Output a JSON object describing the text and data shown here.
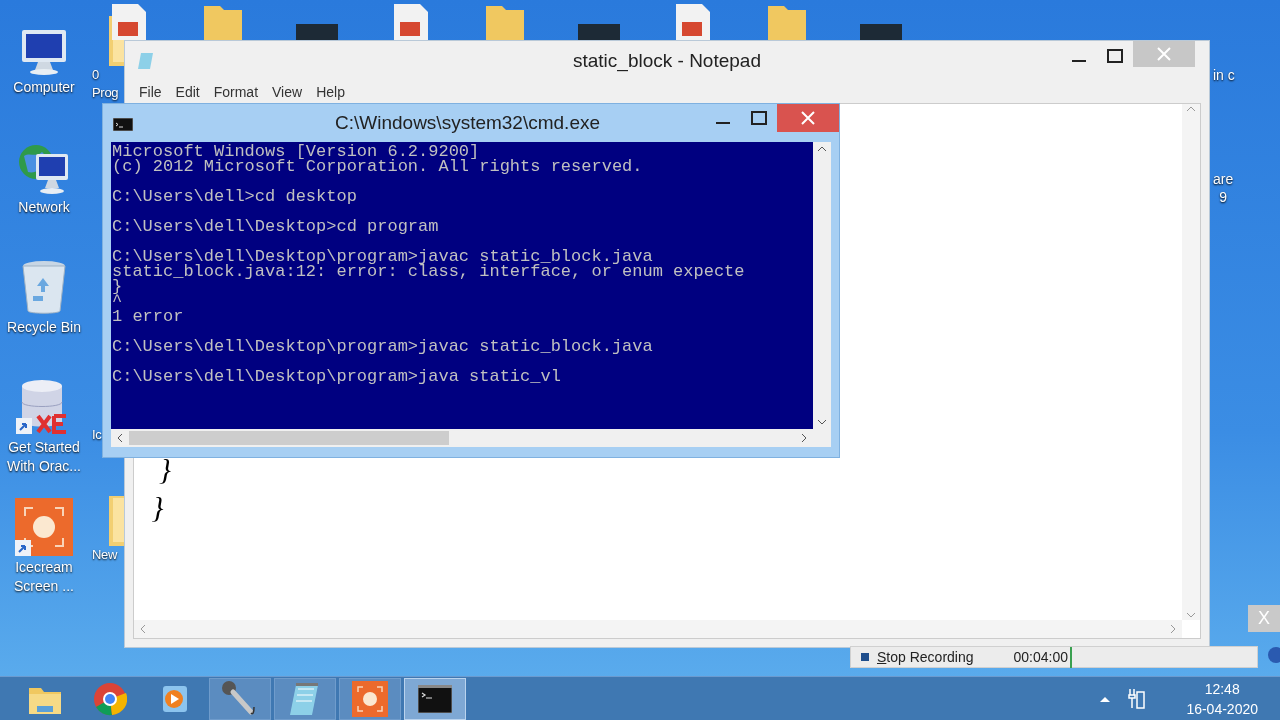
{
  "desktop_icons": [
    {
      "label": "Computer",
      "kind": "computer"
    },
    {
      "label": "Network",
      "kind": "network"
    },
    {
      "label": "Recycle Bin",
      "kind": "recycle"
    },
    {
      "label": "Get Started With Orac...",
      "kind": "database"
    },
    {
      "label": "Icecream Screen ...",
      "kind": "recorder"
    }
  ],
  "partial_icons_left": [
    {
      "lines": [
        "0",
        "Prog"
      ]
    },
    {
      "lines": [
        "Ic"
      ]
    },
    {
      "lines": [
        "New"
      ]
    }
  ],
  "partial_icons_right": [
    {
      "lines": [
        "in c"
      ]
    },
    {
      "lines": [
        "are",
        "9"
      ]
    }
  ],
  "notepad": {
    "title": "static_block - Notepad",
    "menu": [
      "File",
      "Edit",
      "Format",
      "View",
      "Help"
    ],
    "lines": [
      "  }",
      " }"
    ]
  },
  "cmd": {
    "title": "C:\\Windows\\system32\\cmd.exe",
    "blocks": [
      [
        "Microsoft Windows [Version 6.2.9200]",
        "(c) 2012 Microsoft Corporation. All rights reserved."
      ],
      [
        "C:\\Users\\dell>cd desktop"
      ],
      [
        "C:\\Users\\dell\\Desktop>cd program"
      ],
      [
        "C:\\Users\\dell\\Desktop\\program>javac static_block.java",
        "static_block.java:12: error: class, interface, or enum expecte",
        "}",
        "^",
        "1 error"
      ],
      [
        "C:\\Users\\dell\\Desktop\\program>javac static_block.java"
      ],
      [
        "C:\\Users\\dell\\Desktop\\program>java static_vl"
      ]
    ]
  },
  "recording": {
    "stop_key": "S",
    "stop_rest": "top Recording",
    "time": "00:04:00"
  },
  "dialog_close": "X",
  "taskbar": [
    {
      "kind": "explorer",
      "running": false,
      "selected": false
    },
    {
      "kind": "chrome",
      "running": false,
      "selected": false
    },
    {
      "kind": "media",
      "running": false,
      "selected": false
    },
    {
      "kind": "mic",
      "running": true,
      "selected": false
    },
    {
      "kind": "notepad",
      "running": true,
      "selected": false
    },
    {
      "kind": "recorder",
      "running": true,
      "selected": false
    },
    {
      "kind": "console",
      "running": true,
      "selected": true
    }
  ],
  "clock": {
    "time": "12:48",
    "date": "16-04-2020"
  }
}
